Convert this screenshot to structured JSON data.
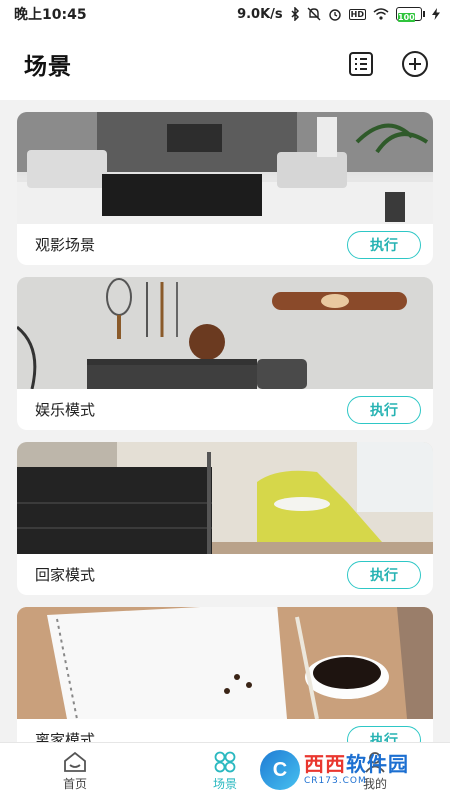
{
  "status_bar": {
    "time": "晚上10:45",
    "network_speed": "9.0K/s",
    "battery": "100"
  },
  "header": {
    "title": "场景",
    "icons": [
      "list-icon",
      "plus-circle-icon"
    ]
  },
  "scenes": [
    {
      "name": "观影场景",
      "action": "执行",
      "image": "living-room-photo"
    },
    {
      "name": "娱乐模式",
      "action": "执行",
      "image": "sports-wall-photo"
    },
    {
      "name": "回家模式",
      "action": "执行",
      "image": "bedroom-photo"
    },
    {
      "name": "离家模式",
      "action": "执行",
      "image": "notebook-coffee-photo"
    }
  ],
  "tabs": [
    {
      "label": "首页",
      "icon": "home-icon",
      "active": false
    },
    {
      "label": "场景",
      "icon": "scene-icon",
      "active": true
    },
    {
      "label": "我的",
      "icon": "user-icon",
      "active": false
    }
  ],
  "watermark": {
    "main_a": "西西",
    "main_b": "软件园",
    "sub": "CR173.COM"
  },
  "colors": {
    "accent": "#2ec7c6",
    "background": "#f2f2f2"
  }
}
